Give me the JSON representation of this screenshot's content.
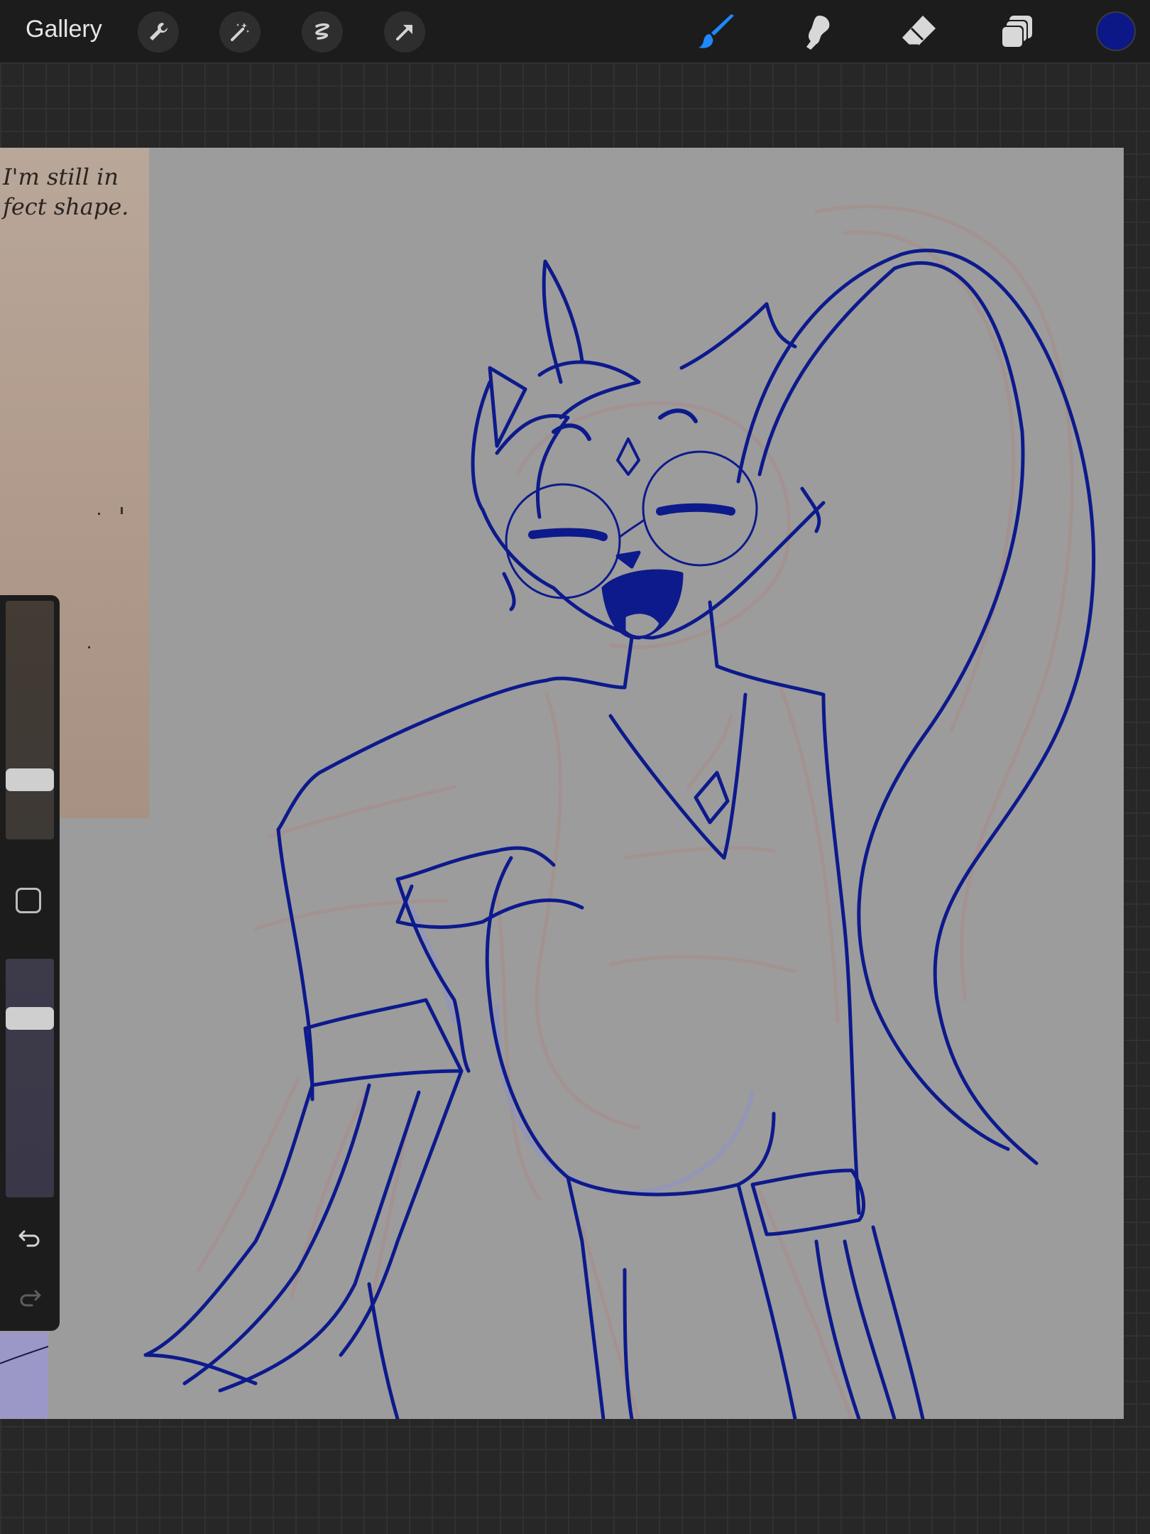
{
  "app": {
    "gallery_label": "Gallery"
  },
  "toolbar": {
    "left_tools": [
      "wrench-icon",
      "magic-wand-icon",
      "selection-icon",
      "transform-arrow-icon"
    ],
    "right_tools": [
      "brush-icon",
      "smudge-icon",
      "eraser-icon",
      "layers-icon"
    ],
    "active_tool": "brush",
    "current_color": "#0c1788"
  },
  "sidebar": {
    "brush_size_level": 0.25,
    "opacity_level": 0.75,
    "icons": [
      "modify-square-icon",
      "undo-icon",
      "redo-icon"
    ]
  },
  "canvas": {
    "reference_note": "I'm still in\nfect shape.",
    "sketch_color": "#0d1a8c",
    "underlay_color": "#a4918f"
  }
}
